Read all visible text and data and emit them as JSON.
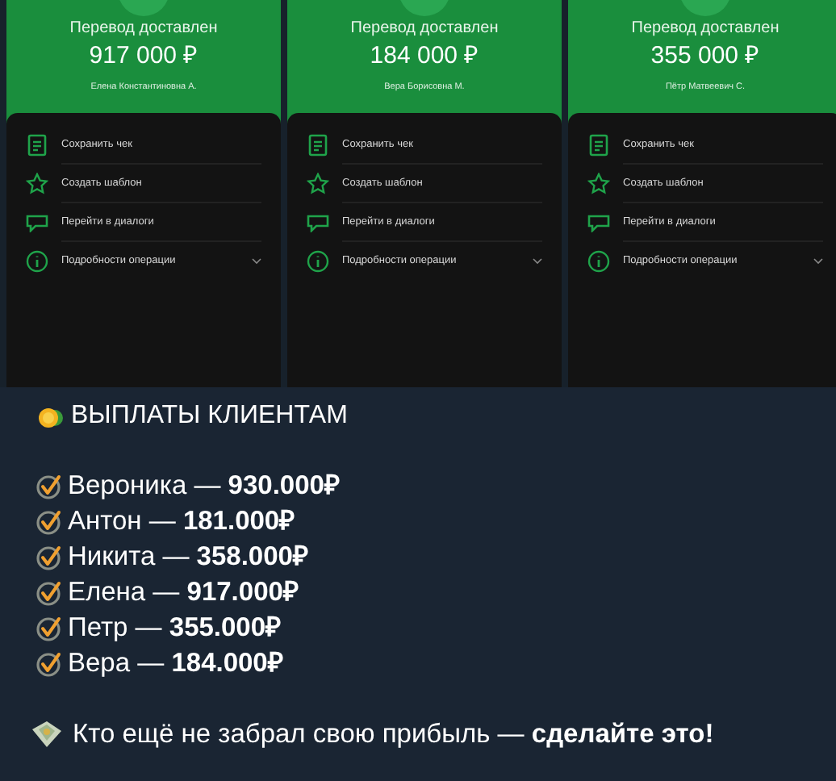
{
  "receipts": [
    {
      "title": "Перевод доставлен",
      "amount": "917 000 ₽",
      "recipient": "Елена Константиновна А.",
      "actions": [
        {
          "kind": "receipt",
          "label": "Сохранить чек"
        },
        {
          "kind": "star",
          "label": "Создать шаблон"
        },
        {
          "kind": "chat",
          "label": "Перейти в диалоги"
        },
        {
          "kind": "info",
          "label": "Подробности операции"
        }
      ]
    },
    {
      "title": "Перевод доставлен",
      "amount": "184 000 ₽",
      "recipient": "Вера Борисовна М.",
      "actions": [
        {
          "kind": "receipt",
          "label": "Сохранить чек"
        },
        {
          "kind": "star",
          "label": "Создать шаблон"
        },
        {
          "kind": "chat",
          "label": "Перейти в диалоги"
        },
        {
          "kind": "info",
          "label": "Подробности операции"
        }
      ]
    },
    {
      "title": "Перевод доставлен",
      "amount": "355 000 ₽",
      "recipient": "Пётр Матвеевич С.",
      "actions": [
        {
          "kind": "receipt",
          "label": "Сохранить чек"
        },
        {
          "kind": "star",
          "label": "Создать шаблон"
        },
        {
          "kind": "chat",
          "label": "Перейти в диалоги"
        },
        {
          "kind": "info",
          "label": "Подробности операции"
        }
      ]
    }
  ],
  "message": {
    "title": "ВЫПЛАТЫ КЛИЕНТАМ",
    "lines": [
      "Вероника — **930.000₽**",
      "Антон — **181.000₽**",
      "Никита — **358.000₽**",
      "Елена — **917.000₽**",
      "Петр — **355.000₽**",
      "Вера — **184.000₽**"
    ],
    "footer": "Кто ещё не забрал свою прибыль — **сделайте это!**"
  }
}
